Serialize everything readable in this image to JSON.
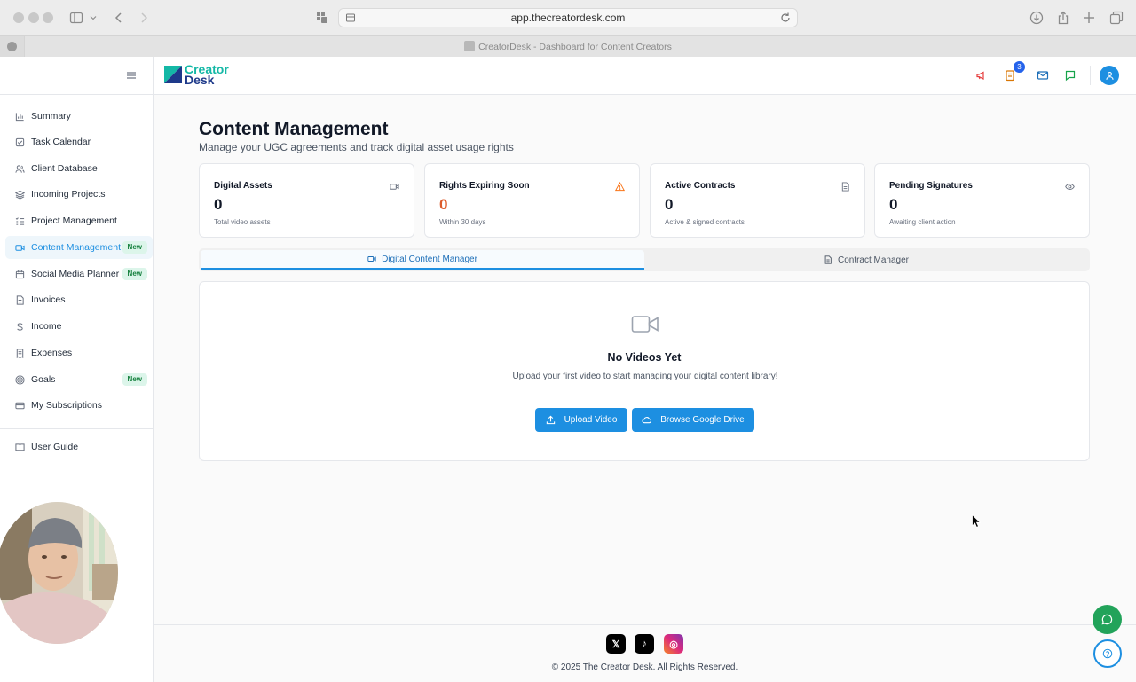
{
  "browser": {
    "url": "app.thecreatordesk.com",
    "tab_title": "CreatorDesk - Dashboard for Content Creators"
  },
  "brand": {
    "line1": "Creator",
    "line2": "Desk",
    "colors": {
      "teal": "#14b8a6",
      "navy": "#1e3a8a"
    }
  },
  "header": {
    "notification_count": "3"
  },
  "sidebar": {
    "items": [
      {
        "label": "Summary",
        "icon": "bar-chart-icon"
      },
      {
        "label": "Task Calendar",
        "icon": "checkbox-icon"
      },
      {
        "label": "Client Database",
        "icon": "users-icon"
      },
      {
        "label": "Incoming Projects",
        "icon": "layers-icon"
      },
      {
        "label": "Project Management",
        "icon": "list-icon"
      },
      {
        "label": "Content Management",
        "icon": "video-icon",
        "badge": "New",
        "active": true
      },
      {
        "label": "Social Media Planner",
        "icon": "calendar-icon",
        "badge": "New"
      },
      {
        "label": "Invoices",
        "icon": "file-icon"
      },
      {
        "label": "Income",
        "icon": "dollar-icon"
      },
      {
        "label": "Expenses",
        "icon": "receipt-icon"
      },
      {
        "label": "Goals",
        "icon": "target-icon",
        "badge": "New"
      },
      {
        "label": "My Subscriptions",
        "icon": "card-icon"
      }
    ],
    "guide": {
      "label": "User Guide",
      "icon": "book-icon"
    }
  },
  "page": {
    "title": "Content Management",
    "subtitle": "Manage your UGC agreements and track digital asset usage rights"
  },
  "stats": [
    {
      "title": "Digital Assets",
      "value": "0",
      "sub": "Total video assets",
      "icon": "video-icon"
    },
    {
      "title": "Rights Expiring Soon",
      "value": "0",
      "sub": "Within 30 days",
      "icon": "warning-icon"
    },
    {
      "title": "Active Contracts",
      "value": "0",
      "sub": "Active & signed contracts",
      "icon": "document-icon"
    },
    {
      "title": "Pending Signatures",
      "value": "0",
      "sub": "Awaiting client action",
      "icon": "eye-icon"
    }
  ],
  "tabs": [
    {
      "label": "Digital Content Manager",
      "active": true
    },
    {
      "label": "Contract Manager",
      "active": false
    }
  ],
  "empty_state": {
    "title": "No Videos Yet",
    "description": "Upload your first video to start managing your digital content library!",
    "upload_label": "Upload Video",
    "drive_label": "Browse Google Drive"
  },
  "footer": {
    "copyright": "©  2025 The Creator Desk. All Rights Reserved.",
    "x_glyph": "𝕏",
    "tiktok_glyph": "♪",
    "instagram_glyph": "◎"
  },
  "accent": "#1d8fe1"
}
